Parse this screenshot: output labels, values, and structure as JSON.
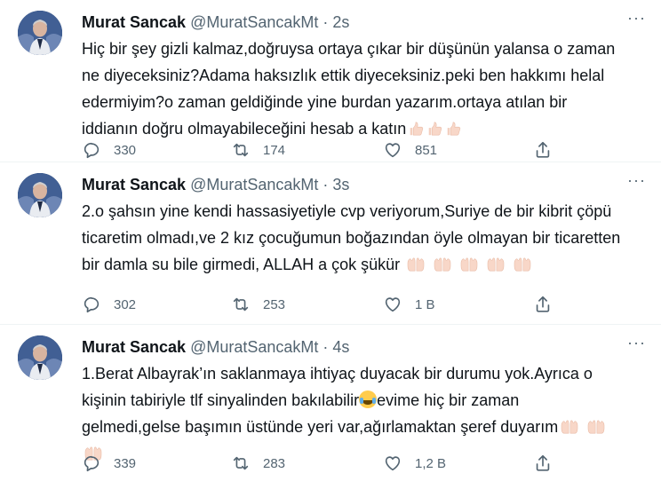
{
  "tweets": [
    {
      "name": "Murat Sancak",
      "handle": "@MuratSancakMt",
      "dot": "·",
      "time": "2s",
      "lines": [
        "Hiç bir şey gizli kalmaz,doğruysa ortaya çıkar bir düşünün yalansa o zaman",
        "ne diyeceksiniz?Adama haksızlık ettik diyeceksiniz.peki ben hakkımı helal",
        "edermiyim?o zaman geldiğinde yine burdan yazarım.ortaya atılan bir",
        "iddianın doğru olmayabileceğini hesab a katın"
      ],
      "emoji": [
        "thumbs-up",
        "thumbs-up",
        "thumbs-up"
      ],
      "replies": "330",
      "retweets": "174",
      "likes": "851"
    },
    {
      "name": "Murat Sancak",
      "handle": "@MuratSancakMt",
      "dot": "·",
      "time": "3s",
      "lines": [
        "2.o şahsın yine kendi hassasiyetiyle cvp veriyorum,Suriye de bir kibrit çöpü",
        "ticaretim olmadı,ve 2 kız çocuğumun boğazından öyle olmayan bir ticaretten",
        "bir damla su bile girmedi, ALLAH a çok şükür"
      ],
      "emoji": [
        "open-hands",
        "open-hands",
        "open-hands",
        "open-hands",
        "open-hands"
      ],
      "replies": "302",
      "retweets": "253",
      "likes": "1 В"
    },
    {
      "name": "Murat Sancak",
      "handle": "@MuratSancakMt",
      "dot": "·",
      "time": "4s",
      "lines": [
        "1.Berat Albayrak’ın saklanmaya ihtiyaç duyacak bir durumu yok.Ayrıca o",
        "kişinin tabiriyle tlf sinyalinden bakılabilir",
        "gelmedi,gelse başımın üstünde yeri var,ağırlamaktan şeref duyarım"
      ],
      "line2_tail": "evime hiç bir zaman",
      "emoji": [
        "open-hands",
        "open-hands",
        "open-hands"
      ],
      "replies": "339",
      "retweets": "283",
      "likes": "1,2 В"
    }
  ],
  "icons": {
    "more": "more-icon",
    "reply": "reply-icon",
    "retweet": "retweet-icon",
    "like": "like-icon",
    "share": "share-icon"
  }
}
